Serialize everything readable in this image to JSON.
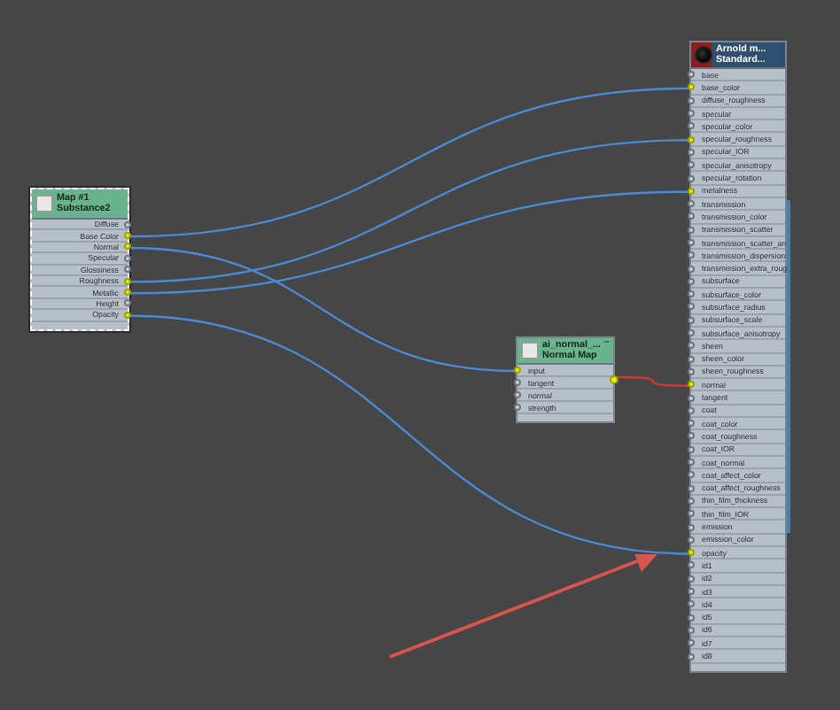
{
  "nodes": [
    {
      "kind": "map",
      "selected": true,
      "title": "Map #1",
      "subtitle": "Substance2",
      "ports": [
        {
          "label": "Diffuse",
          "connected": false
        },
        {
          "label": "Base Color",
          "connected": true
        },
        {
          "label": "Normal",
          "connected": true
        },
        {
          "label": "Specular",
          "connected": false
        },
        {
          "label": "Glossiness",
          "connected": false
        },
        {
          "label": "Roughness",
          "connected": true
        },
        {
          "label": "Metallic",
          "connected": true
        },
        {
          "label": "Height",
          "connected": false
        },
        {
          "label": "Opacity",
          "connected": true
        }
      ]
    },
    {
      "kind": "map",
      "selected": false,
      "title": "ai_normal_...",
      "subtitle": "Normal Map",
      "button": "−",
      "output_connected": true,
      "ports": [
        {
          "label": "input",
          "connected": true
        },
        {
          "label": "tangent",
          "connected": false
        },
        {
          "label": "normal",
          "connected": false
        },
        {
          "label": "strength",
          "connected": false
        }
      ]
    },
    {
      "kind": "material",
      "selected": false,
      "title": "Arnold m...",
      "subtitle": "Standard...",
      "ports": [
        {
          "label": "base",
          "connected": false
        },
        {
          "label": "base_color",
          "connected": true
        },
        {
          "label": "diffuse_roughness",
          "connected": false
        },
        {
          "label": "specular",
          "connected": false
        },
        {
          "label": "specular_color",
          "connected": false
        },
        {
          "label": "specular_roughness",
          "connected": true
        },
        {
          "label": "specular_IOR",
          "connected": false
        },
        {
          "label": "specular_anisotropy",
          "connected": false
        },
        {
          "label": "specular_rotation",
          "connected": false
        },
        {
          "label": "metalness",
          "connected": true
        },
        {
          "label": "transmission",
          "connected": false
        },
        {
          "label": "transmission_color",
          "connected": false
        },
        {
          "label": "transmission_scatter",
          "connected": false
        },
        {
          "label": "transmission_scatter_an",
          "connected": false
        },
        {
          "label": "transmission_dispersion",
          "connected": false
        },
        {
          "label": "transmission_extra_roug",
          "connected": false
        },
        {
          "label": "subsurface",
          "connected": false
        },
        {
          "label": "subsurface_color",
          "connected": false
        },
        {
          "label": "subsurface_radius",
          "connected": false
        },
        {
          "label": "subsurface_scale",
          "connected": false
        },
        {
          "label": "subsurface_anisotropy",
          "connected": false
        },
        {
          "label": "sheen",
          "connected": false
        },
        {
          "label": "sheen_color",
          "connected": false
        },
        {
          "label": "sheen_roughness",
          "connected": false
        },
        {
          "label": "normal",
          "connected": true
        },
        {
          "label": "tangent",
          "connected": false
        },
        {
          "label": "coat",
          "connected": false
        },
        {
          "label": "coat_color",
          "connected": false
        },
        {
          "label": "coat_roughness",
          "connected": false
        },
        {
          "label": "coat_IOR",
          "connected": false
        },
        {
          "label": "coat_normal",
          "connected": false
        },
        {
          "label": "coat_affect_color",
          "connected": false
        },
        {
          "label": "coat_affect_roughness",
          "connected": false
        },
        {
          "label": "thin_film_thickness",
          "connected": false
        },
        {
          "label": "thin_film_IOR",
          "connected": false
        },
        {
          "label": "emission",
          "connected": false
        },
        {
          "label": "emission_color",
          "connected": false
        },
        {
          "label": "opacity",
          "connected": true
        },
        {
          "label": "id1",
          "connected": false
        },
        {
          "label": "id2",
          "connected": false
        },
        {
          "label": "id3",
          "connected": false
        },
        {
          "label": "id4",
          "connected": false
        },
        {
          "label": "id5",
          "connected": false
        },
        {
          "label": "id6",
          "connected": false
        },
        {
          "label": "id7",
          "connected": false
        },
        {
          "label": "id8",
          "connected": false
        }
      ]
    }
  ],
  "wires": [
    {
      "color": "#4a8ad4"
    },
    {
      "color": "#4a8ad4"
    },
    {
      "color": "#4a8ad4"
    },
    {
      "color": "#4a8ad4"
    },
    {
      "color": "#4a8ad4"
    },
    {
      "color": "#d03838"
    }
  ]
}
